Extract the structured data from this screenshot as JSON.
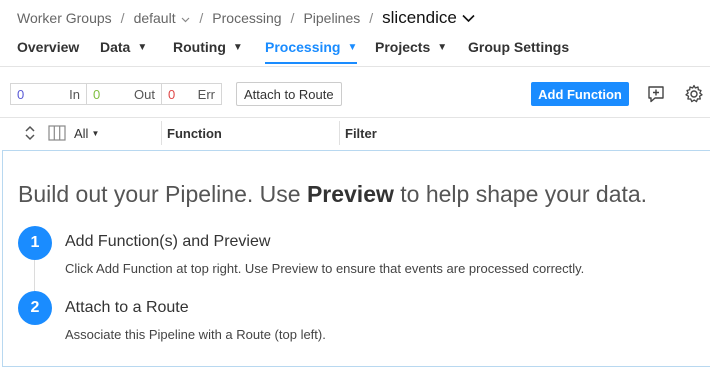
{
  "breadcrumb": {
    "worker_groups": "Worker Groups",
    "group": "default",
    "processing": "Processing",
    "pipelines": "Pipelines",
    "current": "slicendice"
  },
  "tabs": [
    {
      "label": "Overview",
      "has_caret": false
    },
    {
      "label": "Data",
      "has_caret": true
    },
    {
      "label": "Routing",
      "has_caret": true
    },
    {
      "label": "Processing",
      "has_caret": true,
      "active": true
    },
    {
      "label": "Projects",
      "has_caret": true
    },
    {
      "label": "Group Settings",
      "has_caret": false
    }
  ],
  "toolbar": {
    "counters": {
      "in_value": "0",
      "in_label": "In",
      "out_value": "0",
      "out_label": "Out",
      "err_value": "0",
      "err_label": "Err"
    },
    "attach_label": "Attach to Route",
    "add_function_label": "Add Function"
  },
  "columns": {
    "all_label": "All",
    "function": "Function",
    "filter": "Filter"
  },
  "empty_state": {
    "headline_pre": "Build out your Pipeline. Use ",
    "headline_bold": "Preview",
    "headline_post": " to help shape your data.",
    "steps": [
      {
        "number": "1",
        "title": "Add Function(s) and Preview",
        "desc": "Click Add Function at top right. Use Preview to ensure that events are processed correctly."
      },
      {
        "number": "2",
        "title": "Attach to a Route",
        "desc": "Associate this Pipeline with a Route (top left)."
      }
    ]
  },
  "colors": {
    "accent": "#1a8cff",
    "in": "#5b5bd6",
    "out": "#7fbf3f",
    "err": "#e04848"
  }
}
